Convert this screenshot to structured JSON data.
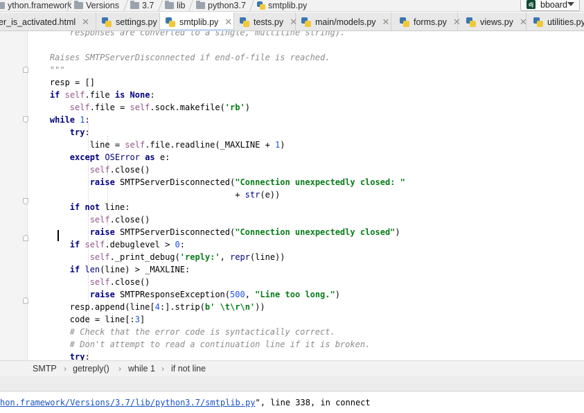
{
  "breadcrumb": [
    {
      "label": "ython.framework",
      "icon": "folder-icon"
    },
    {
      "label": "Versions",
      "icon": "folder-icon"
    },
    {
      "label": "3.7",
      "icon": "folder-icon"
    },
    {
      "label": "lib",
      "icon": "folder-icon"
    },
    {
      "label": "python3.7",
      "icon": "folder-icon"
    },
    {
      "label": "smtplib.py",
      "icon": "python-file-icon"
    }
  ],
  "run_config": {
    "label": "bboard",
    "icon": "django-icon"
  },
  "tabs": [
    {
      "label": "er_is_activated.html",
      "active": false
    },
    {
      "label": "settings.py",
      "active": false
    },
    {
      "label": "smtplib.py",
      "active": true
    },
    {
      "label": "tests.py",
      "active": false
    },
    {
      "label": "main/models.py",
      "active": false
    },
    {
      "label": "forms.py",
      "active": false
    },
    {
      "label": "views.py",
      "active": false
    },
    {
      "label": "utilities.py",
      "active": false
    }
  ],
  "code_lines": [
    [
      {
        "t": "        responses are converted to a single, multiline string).",
        "c": "ds"
      }
    ],
    [
      {
        "t": "",
        "c": ""
      }
    ],
    [
      {
        "t": "    Raises SMTPServerDisconnected if end-of-file is reached.",
        "c": "ds"
      }
    ],
    [
      {
        "t": "    \"\"\"",
        "c": "ds"
      }
    ],
    [
      {
        "t": "    resp = []",
        "c": ""
      }
    ],
    [
      {
        "t": "    ",
        "c": ""
      },
      {
        "t": "if",
        "c": "kw"
      },
      {
        "t": " ",
        "c": ""
      },
      {
        "t": "self",
        "c": "sf"
      },
      {
        "t": ".file ",
        "c": ""
      },
      {
        "t": "is None",
        "c": "kw"
      },
      {
        "t": ":",
        "c": ""
      }
    ],
    [
      {
        "t": "        ",
        "c": ""
      },
      {
        "t": "self",
        "c": "sf"
      },
      {
        "t": ".file = ",
        "c": ""
      },
      {
        "t": "self",
        "c": "sf"
      },
      {
        "t": ".sock.makefile(",
        "c": ""
      },
      {
        "t": "'rb'",
        "c": "st"
      },
      {
        "t": ")",
        "c": ""
      }
    ],
    [
      {
        "t": "    ",
        "c": ""
      },
      {
        "t": "while",
        "c": "kw"
      },
      {
        "t": " ",
        "c": ""
      },
      {
        "t": "1",
        "c": "nm"
      },
      {
        "t": ":",
        "c": ""
      }
    ],
    [
      {
        "t": "        ",
        "c": ""
      },
      {
        "t": "try",
        "c": "kw"
      },
      {
        "t": ":",
        "c": ""
      }
    ],
    [
      {
        "t": "            line = ",
        "c": ""
      },
      {
        "t": "self",
        "c": "sf"
      },
      {
        "t": ".file.readline(_MAXLINE + ",
        "c": ""
      },
      {
        "t": "1",
        "c": "nm"
      },
      {
        "t": ")",
        "c": ""
      }
    ],
    [
      {
        "t": "        ",
        "c": ""
      },
      {
        "t": "except",
        "c": "kw"
      },
      {
        "t": " ",
        "c": ""
      },
      {
        "t": "OSError",
        "c": "bi"
      },
      {
        "t": " ",
        "c": ""
      },
      {
        "t": "as",
        "c": "kw"
      },
      {
        "t": " e:",
        "c": ""
      }
    ],
    [
      {
        "t": "            ",
        "c": ""
      },
      {
        "t": "self",
        "c": "sf"
      },
      {
        "t": ".close()",
        "c": ""
      }
    ],
    [
      {
        "t": "            ",
        "c": ""
      },
      {
        "t": "raise",
        "c": "kw"
      },
      {
        "t": " SMTPServerDisconnected(",
        "c": ""
      },
      {
        "t": "\"Connection unexpectedly closed: \"",
        "c": "st"
      }
    ],
    [
      {
        "t": "                                         + ",
        "c": ""
      },
      {
        "t": "str",
        "c": "bi"
      },
      {
        "t": "(e))",
        "c": ""
      }
    ],
    [
      {
        "t": "        ",
        "c": ""
      },
      {
        "t": "if not",
        "c": "kw"
      },
      {
        "t": " line:",
        "c": ""
      }
    ],
    [
      {
        "t": "            ",
        "c": ""
      },
      {
        "t": "self",
        "c": "sf"
      },
      {
        "t": ".close()",
        "c": ""
      }
    ],
    [
      {
        "t": "            ",
        "c": ""
      },
      {
        "t": "raise",
        "c": "kw"
      },
      {
        "t": " SMTPServerDisconnected(",
        "c": ""
      },
      {
        "t": "\"Connection unexpectedly closed\"",
        "c": "st"
      },
      {
        "t": ")",
        "c": ""
      }
    ],
    [
      {
        "t": "        ",
        "c": ""
      },
      {
        "t": "if",
        "c": "kw"
      },
      {
        "t": " ",
        "c": ""
      },
      {
        "t": "self",
        "c": "sf"
      },
      {
        "t": ".debuglevel > ",
        "c": ""
      },
      {
        "t": "0",
        "c": "nm"
      },
      {
        "t": ":",
        "c": ""
      }
    ],
    [
      {
        "t": "            ",
        "c": ""
      },
      {
        "t": "self",
        "c": "sf"
      },
      {
        "t": "._print_debug(",
        "c": ""
      },
      {
        "t": "'reply:'",
        "c": "st"
      },
      {
        "t": ", ",
        "c": ""
      },
      {
        "t": "repr",
        "c": "bi"
      },
      {
        "t": "(line))",
        "c": ""
      }
    ],
    [
      {
        "t": "        ",
        "c": ""
      },
      {
        "t": "if",
        "c": "kw"
      },
      {
        "t": " ",
        "c": ""
      },
      {
        "t": "len",
        "c": "bi"
      },
      {
        "t": "(line) > _MAXLINE:",
        "c": ""
      }
    ],
    [
      {
        "t": "            ",
        "c": ""
      },
      {
        "t": "self",
        "c": "sf"
      },
      {
        "t": ".close()",
        "c": ""
      }
    ],
    [
      {
        "t": "            ",
        "c": ""
      },
      {
        "t": "raise",
        "c": "kw"
      },
      {
        "t": " SMTPResponseException(",
        "c": ""
      },
      {
        "t": "500",
        "c": "nm"
      },
      {
        "t": ", ",
        "c": ""
      },
      {
        "t": "\"Line too long.\"",
        "c": "st"
      },
      {
        "t": ")",
        "c": ""
      }
    ],
    [
      {
        "t": "        resp.append(line[",
        "c": ""
      },
      {
        "t": "4",
        "c": "nm"
      },
      {
        "t": ":].strip(",
        "c": ""
      },
      {
        "t": "b' \\t\\r\\n'",
        "c": "st"
      },
      {
        "t": "))",
        "c": ""
      }
    ],
    [
      {
        "t": "        code = line[:",
        "c": ""
      },
      {
        "t": "3",
        "c": "nm"
      },
      {
        "t": "]",
        "c": ""
      }
    ],
    [
      {
        "t": "        # Check that the error code is syntactically correct.",
        "c": "cm"
      }
    ],
    [
      {
        "t": "        # Don't attempt to read a continuation line if it is broken.",
        "c": "cm"
      }
    ],
    [
      {
        "t": "        ",
        "c": ""
      },
      {
        "t": "try",
        "c": "kw"
      },
      {
        "t": ":",
        "c": ""
      }
    ]
  ],
  "structure_breadcrumb": [
    "SMTP",
    "getreply()",
    "while 1",
    "if not line"
  ],
  "console": {
    "path": "hon.framework/Versions/3.7/lib/python3.7/smtplib.py",
    "rest": "\", line 338, in connect"
  }
}
